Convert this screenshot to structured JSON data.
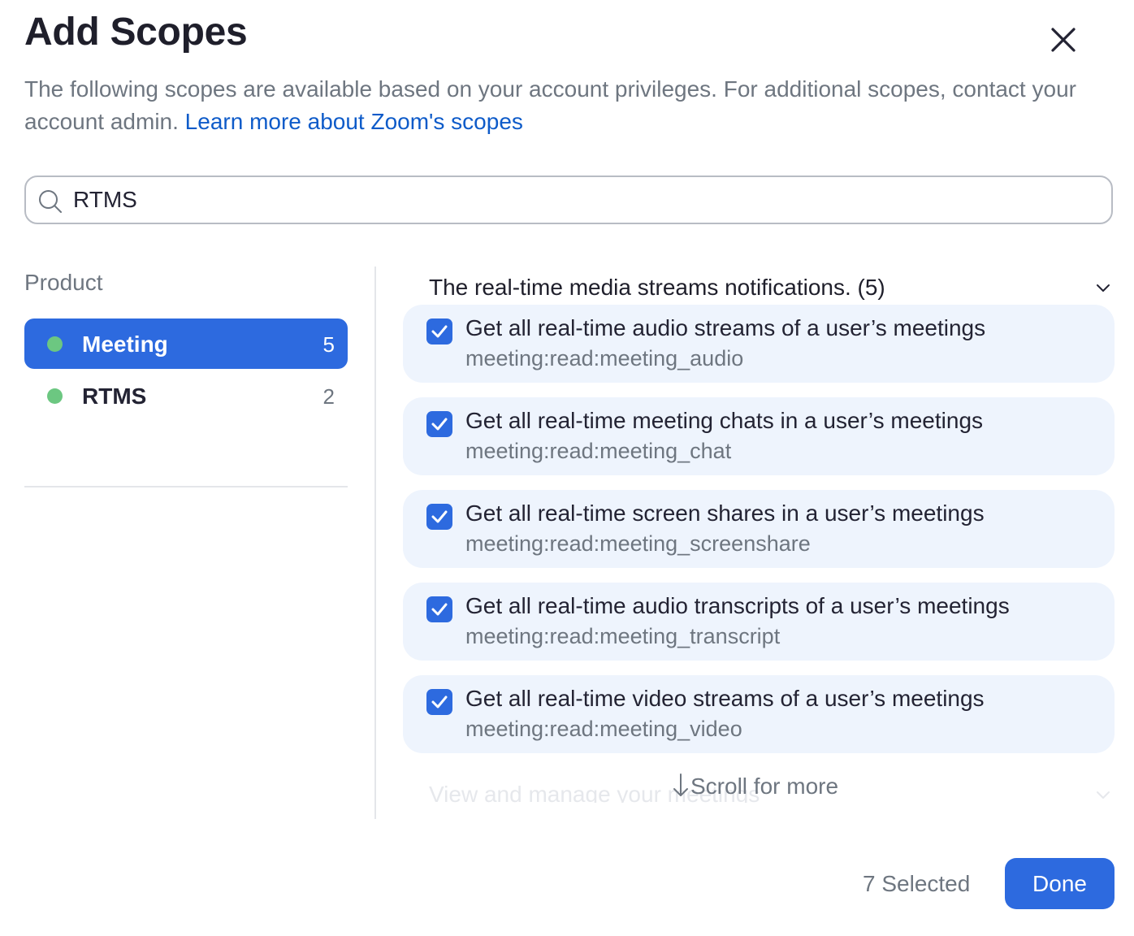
{
  "dialog": {
    "title": "Add Scopes",
    "description": "The following scopes are available based on your account privileges. For additional scopes, contact your account admin.",
    "learn_more_link": "Learn more about Zoom's scopes"
  },
  "search": {
    "value": "RTMS"
  },
  "sidebar": {
    "label": "Product",
    "items": [
      {
        "name": "Meeting",
        "count": "5",
        "active": true,
        "dot_color": "#6cc781"
      },
      {
        "name": "RTMS",
        "count": "2",
        "active": false,
        "dot_color": "#6cc781"
      }
    ]
  },
  "main": {
    "group_title": "The real-time media streams notifications. (5)",
    "scopes": [
      {
        "name": "Get all real-time audio streams of a user’s meetings",
        "id": "meeting:read:meeting_audio",
        "checked": true
      },
      {
        "name": "Get all real-time meeting chats in a user’s meetings",
        "id": "meeting:read:meeting_chat",
        "checked": true
      },
      {
        "name": "Get all real-time screen shares in a user’s meetings",
        "id": "meeting:read:meeting_screenshare",
        "checked": true
      },
      {
        "name": "Get all real-time audio transcripts of a user’s meetings",
        "id": "meeting:read:meeting_transcript",
        "checked": true
      },
      {
        "name": "Get all real-time video streams of a user’s meetings",
        "id": "meeting:read:meeting_video",
        "checked": true
      }
    ],
    "next_group_title_faded": "View and manage your meetings",
    "scroll_hint": "Scroll for more"
  },
  "footer": {
    "selected_text": "7 Selected",
    "done_label": "Done"
  },
  "colors": {
    "accent": "#2d6adf",
    "link": "#0e5bc9",
    "card_bg": "#eef4fd",
    "status_dot": "#6cc781"
  },
  "icons": {
    "close": "close-icon",
    "search": "search-icon",
    "chevron": "chevron-down-icon",
    "check": "checkmark-icon",
    "arrow": "arrow-down-icon"
  }
}
